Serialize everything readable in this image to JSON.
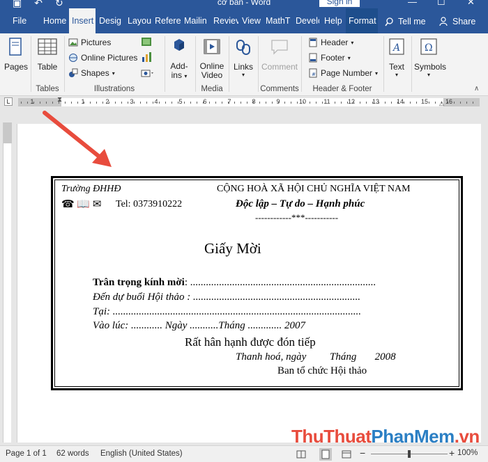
{
  "window": {
    "title": "cơ bản  -  Word",
    "sign_in": "Sign in"
  },
  "tabs": [
    "File",
    "Home",
    "Insert",
    "Design",
    "Layout",
    "References",
    "Mailings",
    "Review",
    "View",
    "MathType",
    "Developer",
    "Help",
    "Format"
  ],
  "tabs_visible": [
    "File",
    "Home",
    "Insert",
    "Desigı",
    "Layou",
    "Referei",
    "Mailin",
    "Reviev",
    "View",
    "MathT",
    "Develc",
    "Help",
    "Format"
  ],
  "tell_me": "Tell me",
  "share": "Share",
  "ribbon": {
    "pages": "Pages",
    "table": "Table",
    "tables_group": "Tables",
    "pictures": "Pictures",
    "online_pictures": "Online Pictures",
    "shapes": "Shapes",
    "illustrations_group": "Illustrations",
    "addins": "Add-\nins",
    "addins_line1": "Add-",
    "addins_line2": "ins",
    "online_video_line1": "Online",
    "online_video_line2": "Video",
    "media_group": "Media",
    "links": "Links",
    "comment": "Comment",
    "comments_group": "Comments",
    "header": "Header",
    "footer": "Footer",
    "page_number": "Page Number",
    "header_footer_group": "Header & Footer",
    "text": "Text",
    "symbols": "Symbols"
  },
  "ruler": {
    "numbers": [
      "1",
      "2",
      "3",
      "4",
      "5",
      "6",
      "7",
      "8",
      "9",
      "10",
      "11",
      "12",
      "13",
      "14",
      "15",
      "16"
    ]
  },
  "document": {
    "school": "Trường ĐHHĐ",
    "contact_icons": "☎ 📖  ✉",
    "tel": "Tel: 0373910222",
    "national_title": "CỘNG HOÀ XÃ HỘI CHỦ NGHĨA VIỆT NAM",
    "motto": "Độc lập – Tự do – Hạnh phúc",
    "divider": "------------***-----------",
    "heading": "Giấy Mời",
    "invite_label": "Trân trọng kính mời",
    "invite_dots": ": .......................................................................",
    "attend_line": "Đến dự buổi Hội thảo : ................................................................",
    "place_line": "Tại: ...............................................................................................",
    "time_line": "Vào lúc: ............ Ngày ...........Tháng ............. 2007",
    "honored": "Rất hân hạnh được đón tiếp",
    "date_line": "Thanh hoá, ngày         Tháng       2008",
    "organizers": "Ban tổ chức Hội thảo"
  },
  "status": {
    "page": "Page 1 of 1",
    "words": "62 words",
    "language": "English (United States)",
    "zoom": "100%"
  },
  "watermark": {
    "part1": "Thu",
    "part2": "Thuat",
    "part3": "Phan",
    "part4": "Mem",
    "part5": ".vn"
  },
  "colors": {
    "accent": "#2b579a",
    "arrow": "#e84c3d"
  }
}
